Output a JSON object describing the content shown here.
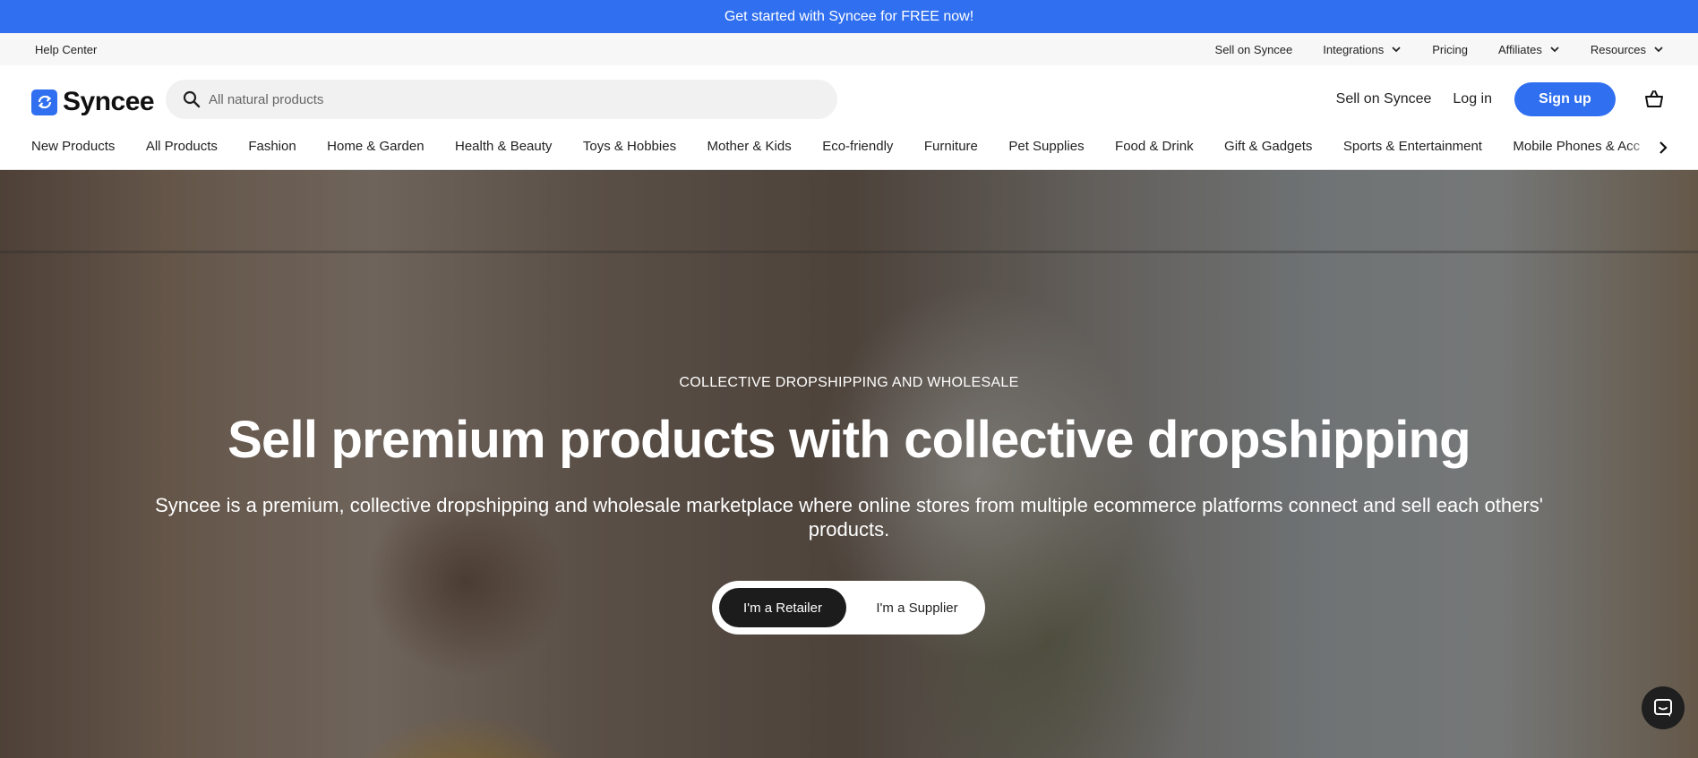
{
  "announcement": {
    "text": "Get started with Syncee for FREE now!"
  },
  "utility": {
    "help": "Help Center",
    "links": [
      {
        "label": "Sell on Syncee",
        "dropdown": false
      },
      {
        "label": "Integrations",
        "dropdown": true
      },
      {
        "label": "Pricing",
        "dropdown": false
      },
      {
        "label": "Affiliates",
        "dropdown": true
      },
      {
        "label": "Resources",
        "dropdown": true
      }
    ]
  },
  "header": {
    "logo": "Syncee",
    "search_placeholder": "All natural products",
    "sell_link": "Sell on Syncee",
    "login": "Log in",
    "signup": "Sign up"
  },
  "categories": [
    "New Products",
    "All Products",
    "Fashion",
    "Home & Garden",
    "Health & Beauty",
    "Toys & Hobbies",
    "Mother & Kids",
    "Eco-friendly",
    "Furniture",
    "Pet Supplies",
    "Food & Drink",
    "Gift & Gadgets",
    "Sports & Entertainment",
    "Mobile Phones & Accessories"
  ],
  "hero": {
    "eyebrow": "COLLECTIVE DROPSHIPPING AND WHOLESALE",
    "title": "Sell premium products with collective dropshipping",
    "description": "Syncee is a premium, collective dropshipping and wholesale marketplace where online stores from multiple ecommerce platforms connect and sell each others' products.",
    "retailer_btn": "I'm a Retailer",
    "supplier_btn": "I'm a Supplier"
  },
  "colors": {
    "brand": "#2f6ff0",
    "dark": "#1c1c1c"
  },
  "icons": [
    "sync-logo-icon",
    "search-icon",
    "chevron-down-icon",
    "cart-icon",
    "chevron-right-icon",
    "chat-icon"
  ]
}
